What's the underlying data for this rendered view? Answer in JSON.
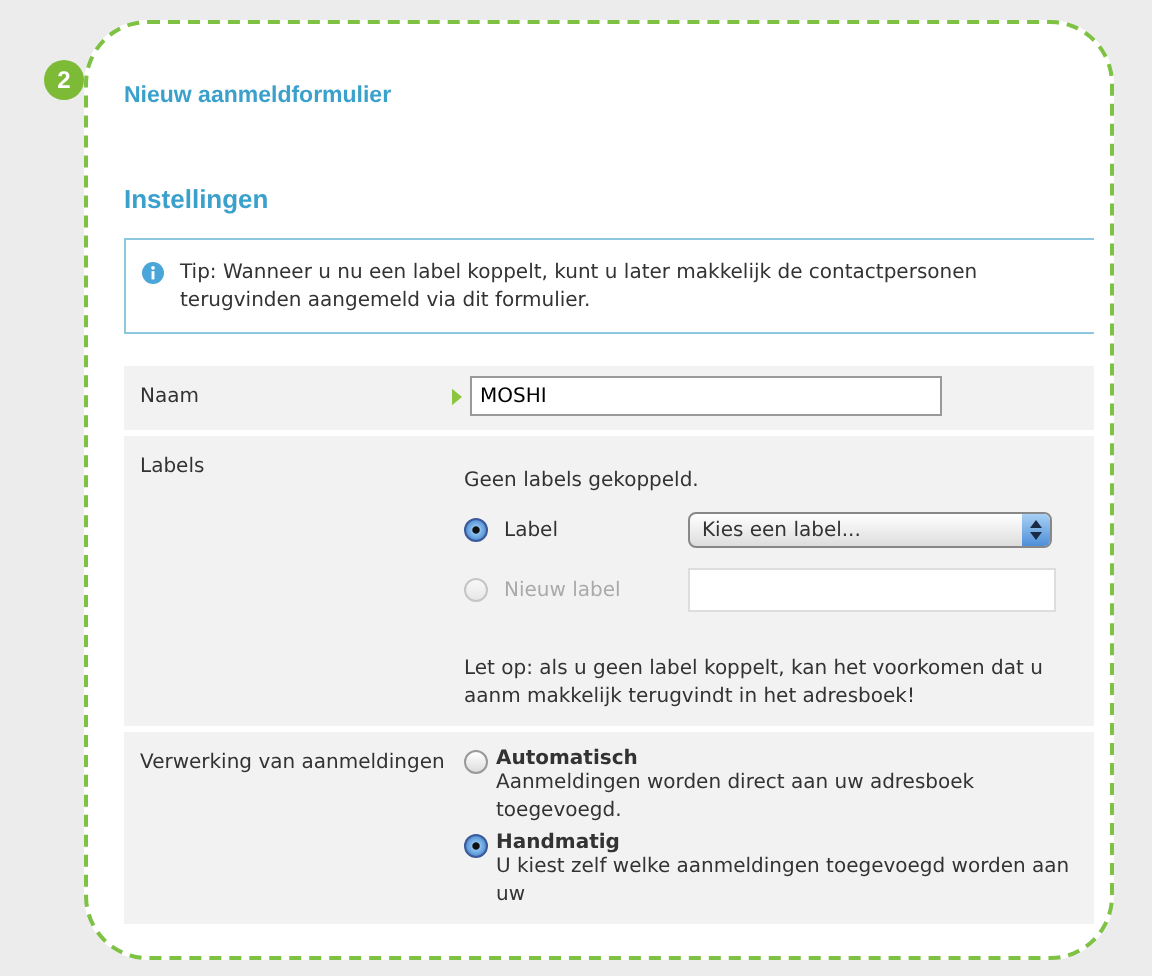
{
  "badge": "2",
  "title": "Nieuw aanmeldformulier",
  "section": "Instellingen",
  "tip": "Tip: Wanneer u nu een label koppelt, kunt u later makkelijk de contactpersonen terugvinden aangemeld via dit formulier.",
  "rows": [
    {
      "kind": "text",
      "label": "Naam",
      "value": "MOSHI"
    },
    {
      "kind": "labels",
      "label": "Labels",
      "note": "Geen labels gekoppeld.",
      "options": [
        {
          "kind": "select",
          "label": "Label",
          "selected": true,
          "disabled": false,
          "value": "Kies een label..."
        },
        {
          "kind": "input",
          "label": "Nieuw label",
          "selected": false,
          "disabled": true
        }
      ],
      "warning": "Let op: als u geen label koppelt, kan het voorkomen dat u aanm makkelijk terugvindt in het adresboek!"
    },
    {
      "kind": "radios",
      "label": "Verwerking van aanmeldingen",
      "options": [
        {
          "label": "Automatisch",
          "description": "Aanmeldingen worden direct aan uw adresboek toegevoegd.",
          "selected": false
        },
        {
          "label": "Handmatig",
          "description": "U kiest zelf welke aanmeldingen toegevoegd worden aan uw",
          "selected": true
        }
      ]
    }
  ]
}
